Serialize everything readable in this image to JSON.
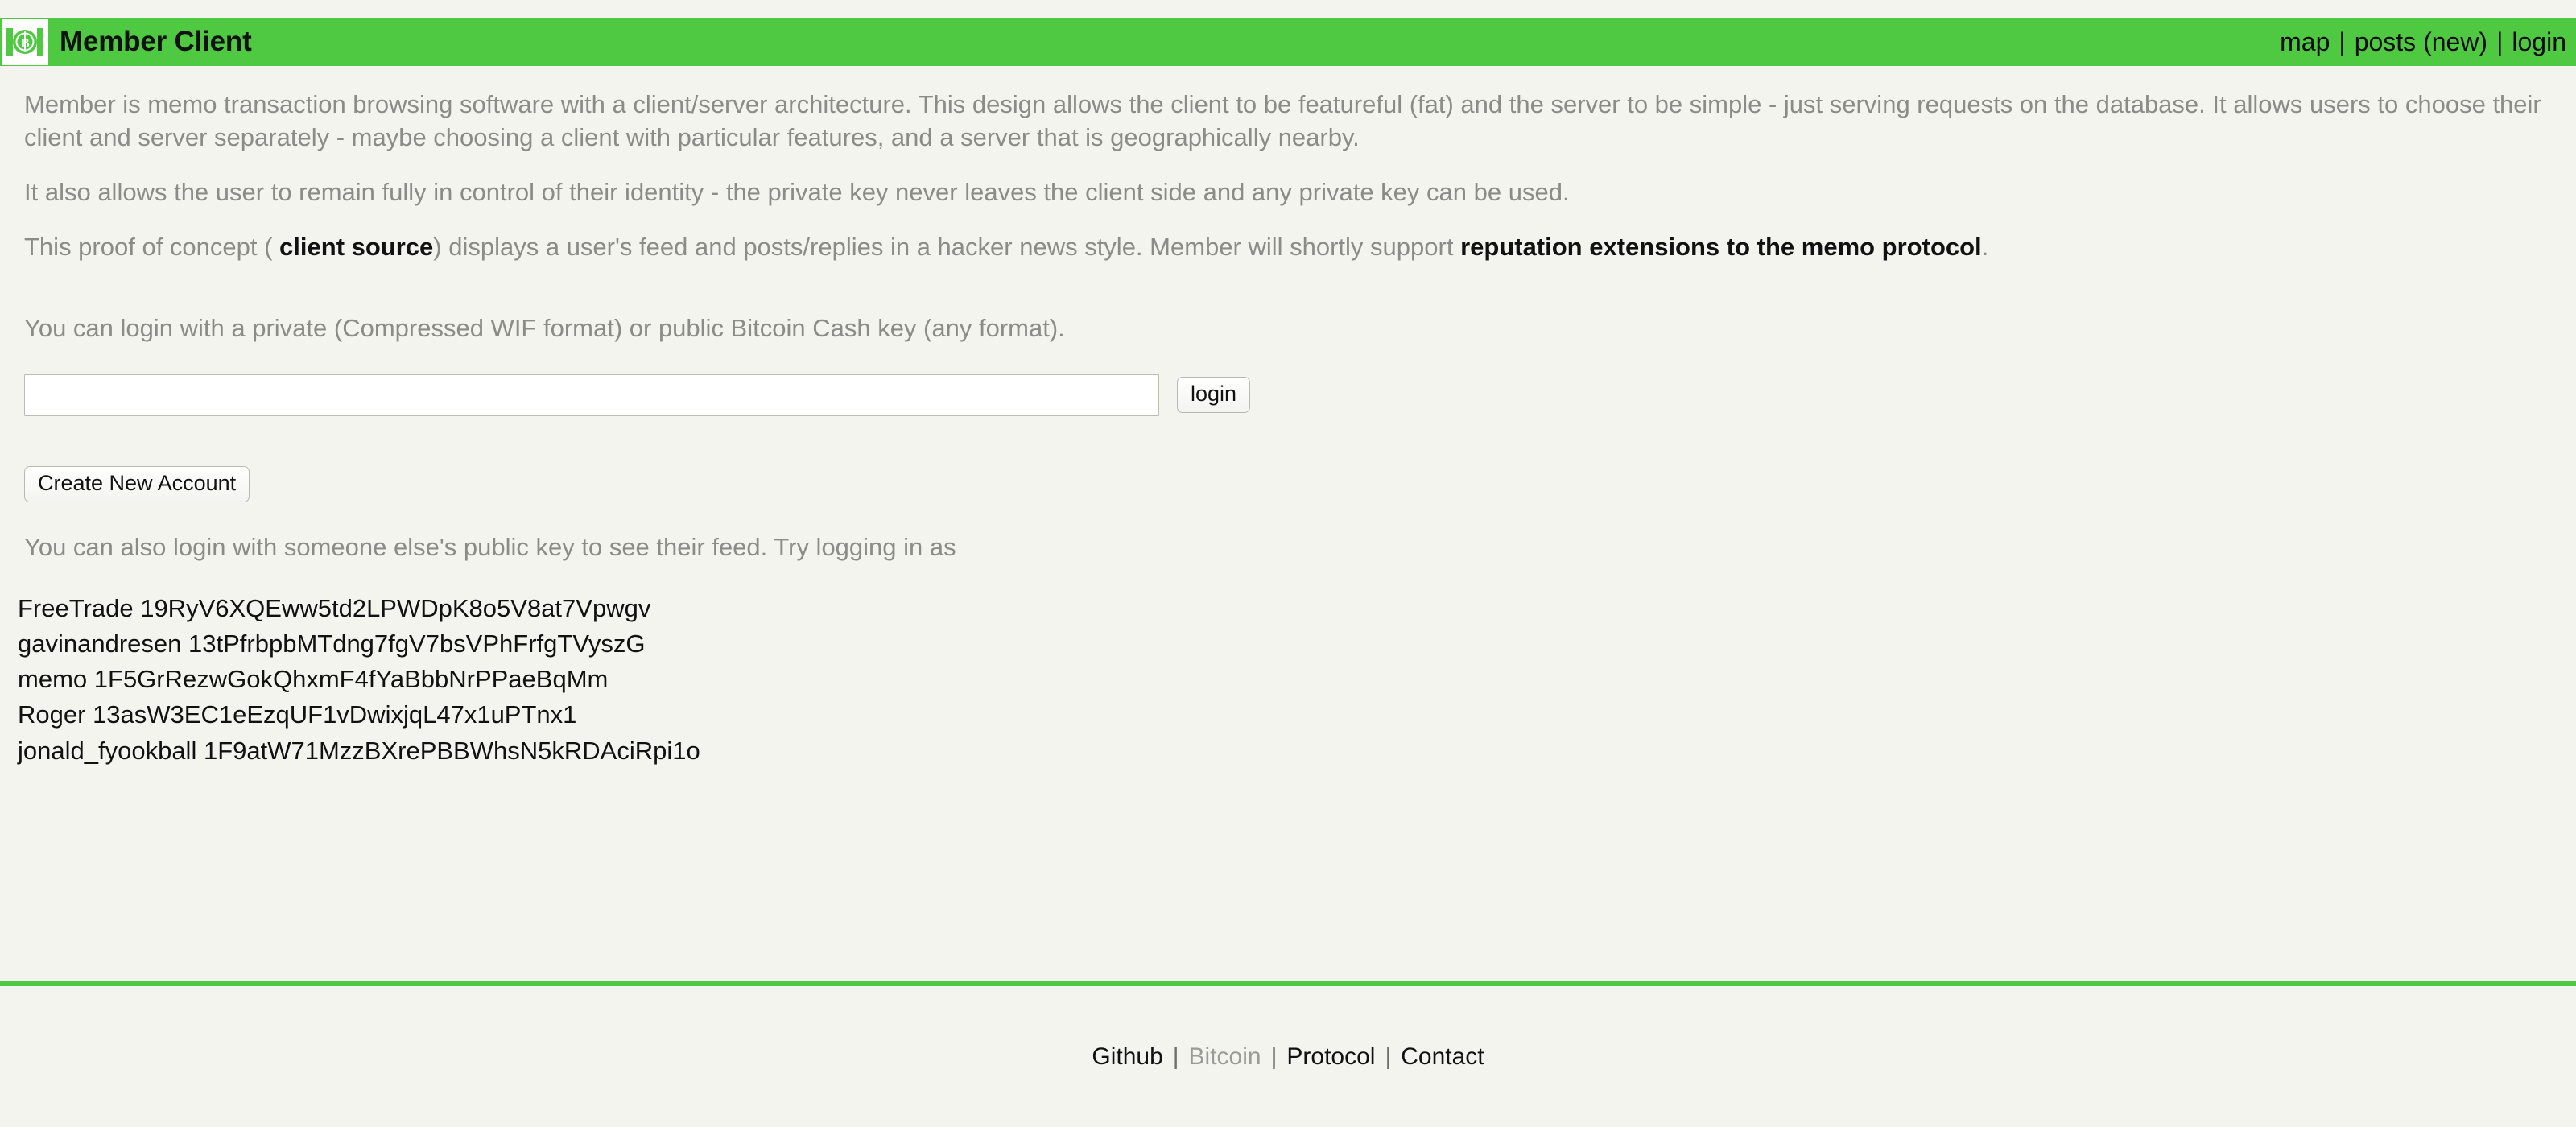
{
  "header": {
    "logo_icon": "bitcoin-cash-banknote-icon",
    "title": "Member Client",
    "nav": [
      {
        "label": "map",
        "name": "nav-map"
      },
      {
        "label": "posts (new)",
        "name": "nav-posts"
      },
      {
        "label": "login",
        "name": "nav-login"
      }
    ],
    "separator": "|",
    "bar_color": "#4ec941"
  },
  "main": {
    "paragraph1": "Member is memo transaction browsing software with a client/server architecture. This design allows the client to be featureful (fat) and the server to be simple - just serving requests on the database. It allows users to choose their client and server separately - maybe choosing a client with particular features, and a server that is geographically nearby.",
    "paragraph2": "It also allows the user to remain fully in control of their identity - the private key never leaves the client side and any private key can be used.",
    "paragraph3": {
      "part1": "This proof of concept ( ",
      "link1": "client source",
      "part2": ") displays a user's feed and posts/replies in a hacker news style. Member will shortly support ",
      "link2": "reputation extensions to the memo protocol",
      "part3": "."
    },
    "login_hint": "You can login with a private (Compressed WIF format) or public Bitcoin Cash key (any format).",
    "key_input": {
      "value": "",
      "placeholder": ""
    },
    "login_button": "login",
    "create_account_button": "Create New Account",
    "also_login_hint": "You can also login with someone else's public key to see their feed. Try logging in as",
    "users": [
      {
        "name": "FreeTrade",
        "address": "19RyV6XQEww5td2LPWDpK8o5V8at7Vpwgv"
      },
      {
        "name": "gavinandresen",
        "address": "13tPfrbpbMTdng7fgV7bsVPhFrfgTVyszG"
      },
      {
        "name": "memo",
        "address": "1F5GrRezwGokQhxmF4fYaBbbNrPPaeBqMm"
      },
      {
        "name": "Roger",
        "address": "13asW3EC1eEzqUF1vDwixjqL47x1uPTnx1"
      },
      {
        "name": "jonald_fyookball",
        "address": "1F9atW71MzzBXrePBBWhsN5kRDAciRpi1o"
      }
    ]
  },
  "footer": {
    "links": [
      {
        "label": "Github",
        "muted": false
      },
      {
        "label": "Bitcoin",
        "muted": true
      },
      {
        "label": "Protocol",
        "muted": false
      },
      {
        "label": "Contact",
        "muted": false
      }
    ],
    "separator": "|",
    "rule_color": "#4ec941"
  }
}
